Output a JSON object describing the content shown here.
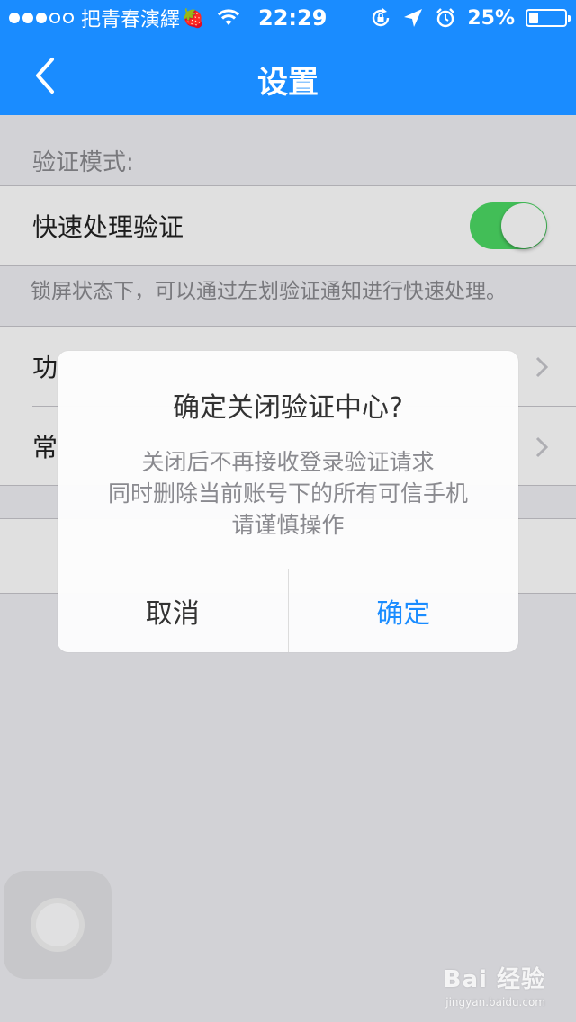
{
  "status_bar": {
    "carrier": "把青春演繹",
    "emoji": "🍓",
    "time": "22:29",
    "battery_percent": "25%",
    "battery_level": 0.25
  },
  "nav": {
    "title": "设置",
    "back_icon": "chevron-left-icon"
  },
  "settings": {
    "section_header": "验证模式:",
    "quick_verify_label": "快速处理验证",
    "quick_verify_on": true,
    "footnote": "锁屏状态下，可以通过左划验证通知进行快速处理。",
    "row_function_label": "功",
    "row_common_label": "常"
  },
  "alert": {
    "title": "确定关闭验证中心?",
    "message_lines": [
      "关闭后不再接收登录验证请求",
      "同时删除当前账号下的所有可信手机",
      "请谨慎操作"
    ],
    "cancel_label": "取消",
    "confirm_label": "确定"
  },
  "watermark": {
    "main": "Bai 经验",
    "sub": "jingyan.baidu.com"
  },
  "colors": {
    "accent": "#1a8cff",
    "toggle_on": "#4cd964"
  }
}
